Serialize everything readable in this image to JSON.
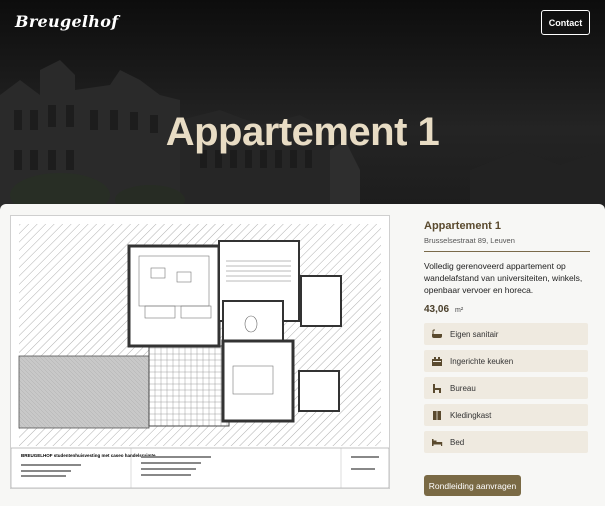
{
  "header": {
    "logo": "Breugelhof",
    "contact_label": "Contact"
  },
  "hero": {
    "title": "Appartement 1"
  },
  "listing": {
    "name": "Appartement 1",
    "address": "Brusselsestraat 89, Leuven",
    "description": "Volledig gerenoveerd appartement op wandelafstand van universiteiten, winkels, openbaar vervoer en horeca.",
    "area_value": "43,06",
    "area_unit": "m²",
    "features": [
      {
        "label": "Eigen sanitair",
        "icon": "bathtub-icon"
      },
      {
        "label": "Ingerichte keuken",
        "icon": "kitchen-icon"
      },
      {
        "label": "Bureau",
        "icon": "desk-chair-icon"
      },
      {
        "label": "Kledingkast",
        "icon": "wardrobe-icon"
      },
      {
        "label": "Bed",
        "icon": "bed-icon"
      }
    ],
    "tour_label": "Rondleiding aanvragen"
  },
  "floorplan": {
    "caption": "BREUGELHOF studentenhuisvesting met caseo handelsruimte"
  },
  "colors": {
    "accent": "#7a6a45",
    "title": "#e8dcc4",
    "feature_bg": "#efeae0"
  }
}
